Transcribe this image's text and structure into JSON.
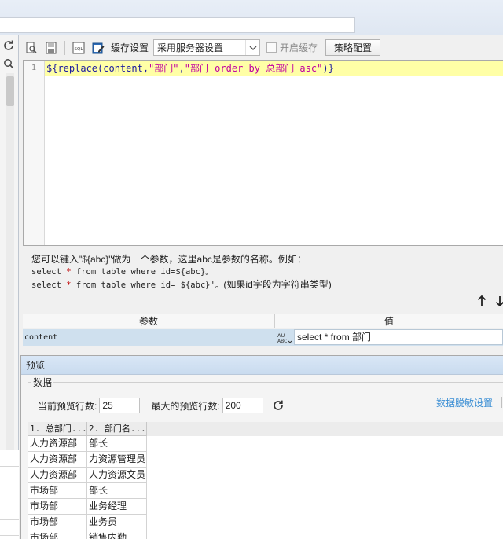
{
  "toolbar": {
    "icons": [
      "search-db-icon",
      "save-icon",
      "sql-icon",
      "edit-icon"
    ],
    "cache_label": "缓存设置",
    "cache_select_value": "采用服务器设置",
    "enable_cache_label": "开启缓存",
    "enable_cache_checked": false,
    "strategy_button": "策略配置"
  },
  "left_strip": {
    "icons": [
      "refresh-icon",
      "search-icon"
    ]
  },
  "editor": {
    "line_number": "1",
    "code": "${replace(content,\"部门\",\"部门 order by 总部门 asc\")}",
    "tokens": {
      "t1": "${replace(content,",
      "t2": "\"部门\"",
      "t3": ",",
      "t4": "\"部门 order by 总部门 asc\"",
      "t5": ")}"
    }
  },
  "help": {
    "intro": "您可以键入\"${abc}\"做为一个参数，这里abc是参数的名称。例如：",
    "line1_a": "select ",
    "line1_star": "*",
    "line1_b": " from table where id=${abc}。",
    "line2_a": "select ",
    "line2_star": "*",
    "line2_b": " from table where id='${abc}'。",
    "line2_note": "(如果id字段为字符串类型)"
  },
  "params": {
    "headers": [
      "参数",
      "值"
    ],
    "rows": [
      {
        "name": "content",
        "type_icon": "string-type-icon",
        "value": "select * from 部门"
      }
    ]
  },
  "preview": {
    "title": "预览",
    "group_label": "数据",
    "current_rows_label": "当前预览行数:",
    "current_rows_value": "25",
    "max_rows_label": "最大的预览行数:",
    "max_rows_value": "200",
    "desensitize_link": "数据脱敏设置",
    "table": {
      "headers": [
        "1. 总部门...",
        "2. 部门名..."
      ],
      "rows": [
        [
          "人力资源部",
          "部长"
        ],
        [
          "人力资源部",
          "力资源管理员"
        ],
        [
          "人力资源部",
          "人力资源文员"
        ],
        [
          "市场部",
          "部长"
        ],
        [
          "市场部",
          "业务经理"
        ],
        [
          "市场部",
          "业务员"
        ],
        [
          "市场部",
          "销售内勤"
        ]
      ]
    }
  },
  "colors": {
    "highlight_line": "#ffffa6",
    "string_token": "#c000a0",
    "link": "#3a8ed4",
    "selected_row": "#cfe0ee"
  }
}
